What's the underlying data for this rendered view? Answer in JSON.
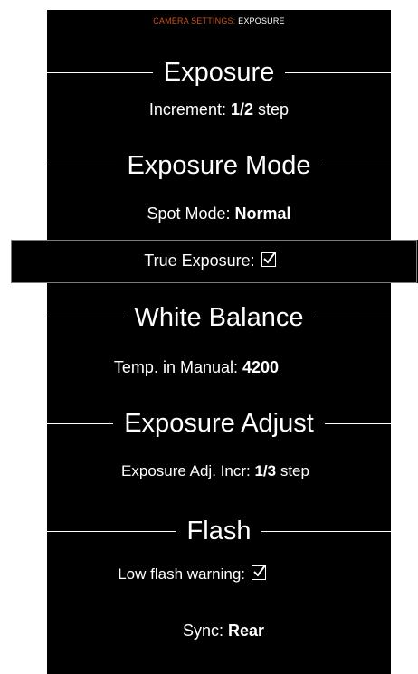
{
  "header": {
    "crumb": "CAMERA SETTINGS:",
    "current": "EXPOSURE"
  },
  "sections": {
    "exposure": "Exposure",
    "exposure_mode": "Exposure Mode",
    "white_balance": "White Balance",
    "exposure_adjust": "Exposure Adjust",
    "flash": "Flash"
  },
  "settings": {
    "increment": {
      "label": "Increment:",
      "value": "1/2",
      "unit": "step"
    },
    "spot_mode": {
      "label": "Spot Mode:",
      "value": "Normal"
    },
    "true_exposure": {
      "label": "True Exposure:",
      "checked": true
    },
    "temp_manual": {
      "label": "Temp. in Manual:",
      "value": "4200"
    },
    "exposure_adj_incr": {
      "label": "Exposure Adj. Incr:",
      "value": "1/3",
      "unit": "step"
    },
    "low_flash_warning": {
      "label": "Low flash warning:",
      "checked": true
    },
    "sync": {
      "label": "Sync:",
      "value": "Rear"
    }
  },
  "colors": {
    "background": "#000000",
    "text": "#ffffff",
    "header_accent": "#c8511e",
    "highlight_border": "#7a7a7a"
  }
}
